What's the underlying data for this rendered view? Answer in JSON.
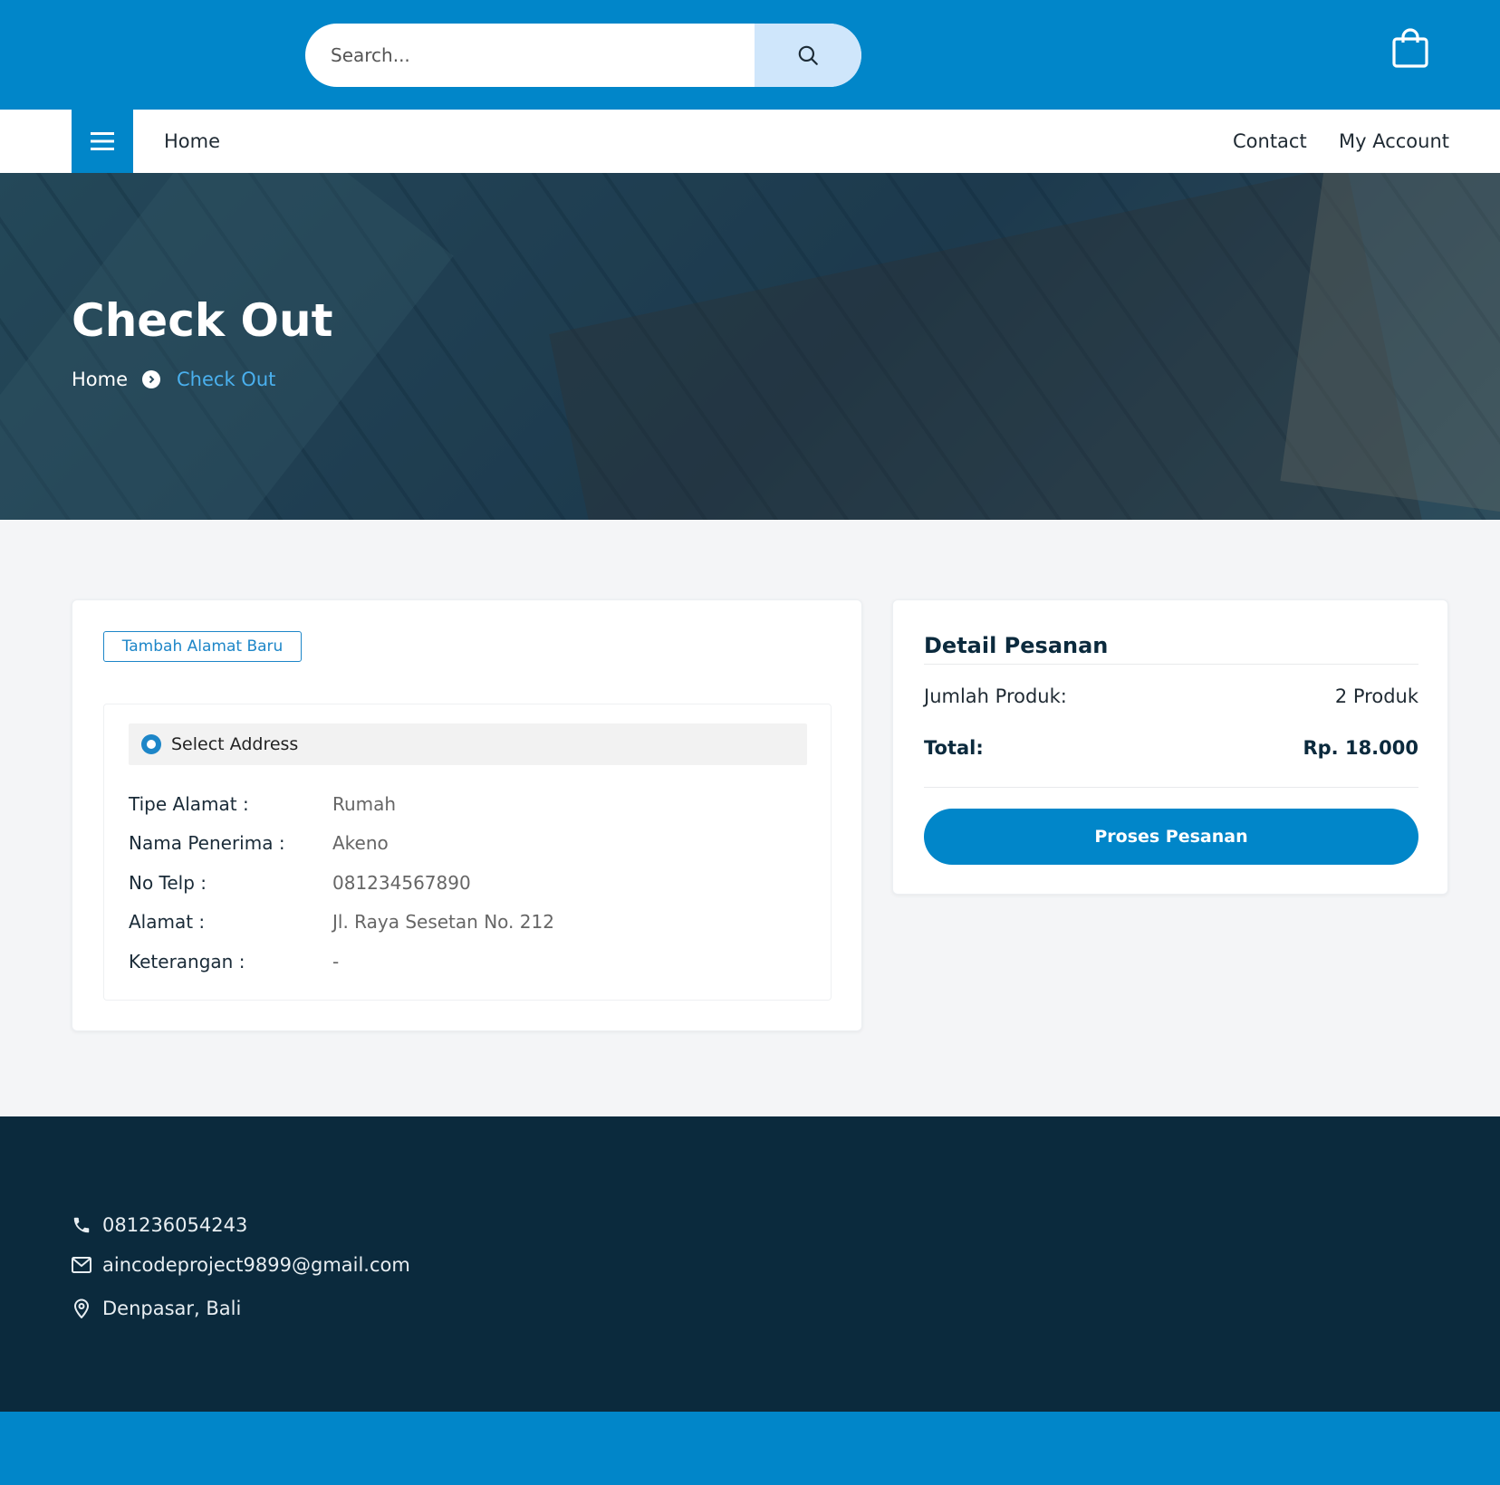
{
  "header": {
    "search_placeholder": "Search...",
    "search_icon": "search-icon",
    "cart_icon": "shopping-bag-icon"
  },
  "nav": {
    "menu_icon": "hamburger-icon",
    "home": "Home",
    "contact": "Contact",
    "my_account": "My Account"
  },
  "hero": {
    "title": "Check Out",
    "breadcrumb": {
      "home": "Home",
      "separator_icon": "chevron-circle-right-icon",
      "current": "Check Out"
    }
  },
  "address": {
    "add_button": "Tambah Alamat Baru",
    "select_label": "Select Address",
    "fields": [
      {
        "label": "Tipe Alamat :",
        "value": "Rumah"
      },
      {
        "label": "Nama Penerima :",
        "value": "Akeno"
      },
      {
        "label": "No Telp :",
        "value": "081234567890"
      },
      {
        "label": "Alamat :",
        "value": "Jl. Raya Sesetan No. 212"
      },
      {
        "label": "Keterangan :",
        "value": "-"
      }
    ]
  },
  "order": {
    "title": "Detail Pesanan",
    "jumlah_label": "Jumlah Produk:",
    "jumlah_value": "2 Produk",
    "total_label": "Total:",
    "total_value": "Rp. 18.000",
    "submit": "Proses Pesanan"
  },
  "footer": {
    "phone": "081236054243",
    "email": "aincodeproject9899@gmail.com",
    "location": "Denpasar, Bali"
  },
  "colors": {
    "primary": "#0186c9",
    "footer_bg": "#0b2a3d",
    "page_bg": "#f4f5f7"
  }
}
